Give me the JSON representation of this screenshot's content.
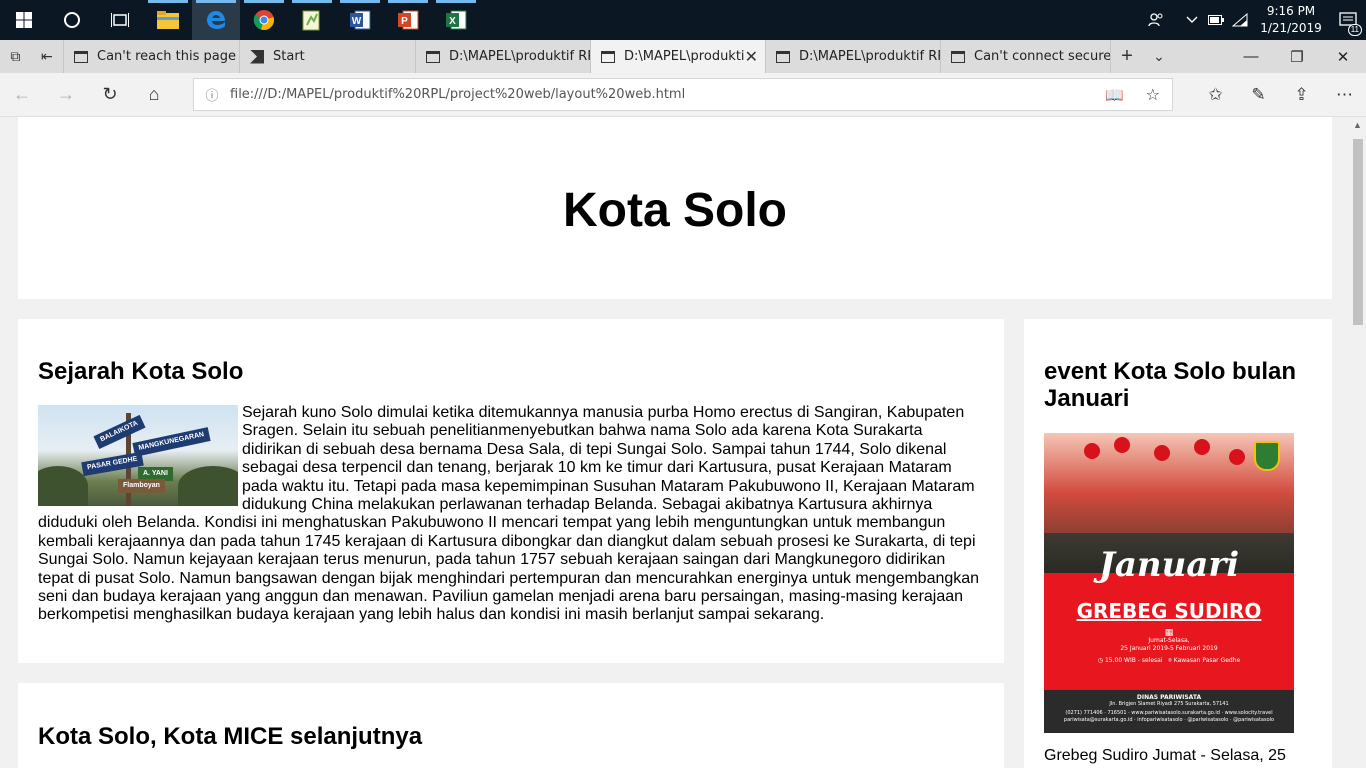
{
  "taskbar": {
    "apps": [
      {
        "name": "start-button",
        "icon": "windows-logo-icon"
      },
      {
        "name": "cortana-button",
        "icon": "search-circle-icon"
      },
      {
        "name": "task-view-button",
        "icon": "task-view-icon"
      },
      {
        "name": "file-explorer-app",
        "icon": "folder-icon"
      },
      {
        "name": "edge-app",
        "icon": "edge-icon"
      },
      {
        "name": "chrome-app",
        "icon": "chrome-icon"
      },
      {
        "name": "notepadpp-app",
        "icon": "notepad-icon"
      },
      {
        "name": "word-app",
        "icon": "word-icon"
      },
      {
        "name": "powerpoint-app",
        "icon": "powerpoint-icon"
      },
      {
        "name": "excel-app",
        "icon": "excel-icon"
      }
    ],
    "time": "9:16 PM",
    "date": "1/21/2019",
    "notification_count": "11"
  },
  "tabs": [
    {
      "title": "Can't reach this page",
      "active": false
    },
    {
      "title": "Start",
      "active": false
    },
    {
      "title": "D:\\MAPEL\\produktif RP",
      "active": false
    },
    {
      "title": "D:\\MAPEL\\produkti",
      "active": true
    },
    {
      "title": "D:\\MAPEL\\produktif RP",
      "active": false
    },
    {
      "title": "Can't connect securely",
      "active": false
    }
  ],
  "address": {
    "url": "file:///D:/MAPEL/produktif%20RPL/project%20web/layout%20web.html"
  },
  "page": {
    "title": "Kota Solo",
    "article1": {
      "heading": "Sejarah Kota Solo",
      "image_alt": "PASAR GEDHE",
      "sign_labels": [
        "BALAIKOTA",
        "MANGKUNEGARAN",
        "PASAR GEDHE",
        "A. YANI",
        "Flamboyan"
      ],
      "body": "Sejarah kuno Solo dimulai ketika ditemukannya manusia purba Homo erectus di Sangiran, Kabupaten Sragen. Selain itu sebuah penelitianmenyebutkan bahwa nama Solo ada karena Kota Surakarta didirikan di sebuah desa bernama Desa Sala, di tepi Sungai Solo. Sampai tahun 1744, Solo dikenal sebagai desa terpencil dan tenang, berjarak 10 km ke timur dari Kartusura, pusat Kerajaan Mataram pada waktu itu. Tetapi pada masa kepemimpinan Susuhan Mataram Pakubuwono II, Kerajaan Mataram didukung China melakukan perlawanan terhadap Belanda. Sebagai akibatnya Kartusura akhirnya diduduki oleh Belanda. Kondisi ini menghatuskan Pakubuwono II mencari tempat yang lebih menguntungkan untuk membangun kembali kerajaannya dan pada tahun 1745 kerajaan di Kartusura dibongkar dan diangkut dalam sebuah prosesi ke Surakarta, di tepi Sungai Solo. Namun kejayaan kerajaan terus menurun, pada tahun 1757 sebuah kerajaan saingan dari Mangkunegoro didirikan tepat di pusat Solo. Namun bangsawan dengan bijak menghindari pertempuran dan mencurahkan energinya untuk mengembangkan seni dan budaya kerajaan yang anggun dan menawan. Paviliun gamelan menjadi arena baru persaingan, masing-masing kerajaan berkompetisi menghasilkan budaya kerajaan yang lebih halus dan kondisi ini masih berlanjut sampai sekarang."
    },
    "article2": {
      "heading": "Kota Solo, Kota MICE selanjutnya"
    },
    "sidebar": {
      "heading": "event Kota Solo bulan Januari",
      "poster": {
        "title_script": "Januari",
        "event_name": "GREBEG SUDIRO",
        "date_line": "Jumat-Selasa,",
        "date_range": "25 Januari 2019-5 Februari 2019",
        "time_line": "15.00 WIB - selesai",
        "place_line": "Kawasan Pasar Gedhe",
        "org": "DINAS PARIWISATA",
        "org_address": "Jln. Brigjen Slamet Riyadi 275 Surakarta, 57141",
        "contacts": "(0271) 771406 · 716501 · www.pariwisatasolo.surakarta.go.id · www.solocity.travel",
        "socials": "pariwisata@surakarta.go.id · infopariwisatasolo · @pariwisatasolo · @pariwisatasolo"
      },
      "caption": "Grebeg Sudiro Jumat - Selasa, 25"
    }
  },
  "colors": {
    "taskbar": "#0b1823",
    "tabbar": "#dcdcdc",
    "page_bg": "#f1f1f1",
    "card_bg": "#ffffff",
    "poster_red": "#e8171f"
  }
}
